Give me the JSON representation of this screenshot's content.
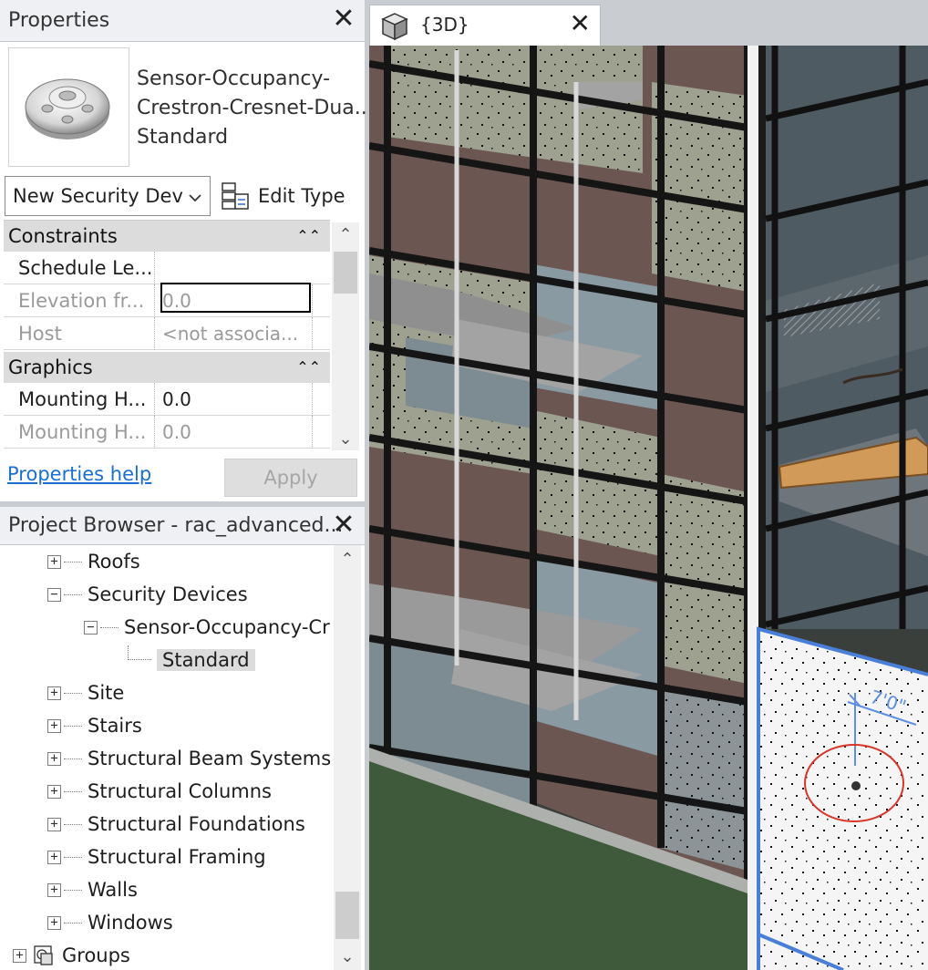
{
  "properties": {
    "title": "Properties",
    "type_lines": [
      "Sensor-Occupancy-",
      "Crestron-Cresnet-Dua...",
      "Standard"
    ],
    "type_selector_value": "New Security Dev",
    "edit_type_label": "Edit Type",
    "categories": [
      {
        "name": "Constraints",
        "rows": [
          {
            "name": "Schedule Le...",
            "value": ""
          },
          {
            "name": "Elevation fr...",
            "value": "0.0"
          },
          {
            "name": "Host",
            "value": "<not associa..."
          }
        ]
      },
      {
        "name": "Graphics",
        "rows": [
          {
            "name": "Mounting H...",
            "value": "0.0"
          },
          {
            "name": "Mounting H...",
            "value": "0.0"
          }
        ]
      }
    ],
    "help_link": "Properties help",
    "apply_label": "Apply"
  },
  "browser": {
    "title": "Project Browser - rac_advanced...",
    "nodes": [
      {
        "label": "Roofs",
        "level": 1,
        "expander": "+"
      },
      {
        "label": "Security Devices",
        "level": 1,
        "expander": "−"
      },
      {
        "label": "Sensor-Occupancy-Cr",
        "level": 2,
        "expander": "−"
      },
      {
        "label": "Standard",
        "level": 3,
        "expander": ""
      },
      {
        "label": "Site",
        "level": 1,
        "expander": "+"
      },
      {
        "label": "Stairs",
        "level": 1,
        "expander": "+"
      },
      {
        "label": "Structural Beam Systems",
        "level": 1,
        "expander": "+"
      },
      {
        "label": "Structural Columns",
        "level": 1,
        "expander": "+"
      },
      {
        "label": "Structural Foundations",
        "level": 1,
        "expander": "+"
      },
      {
        "label": "Structural Framing",
        "level": 1,
        "expander": "+"
      },
      {
        "label": "Walls",
        "level": 1,
        "expander": "+"
      },
      {
        "label": "Windows",
        "level": 1,
        "expander": "+"
      },
      {
        "label": "Groups",
        "level": 0,
        "expander": "+"
      }
    ]
  },
  "view": {
    "tab_label": "{3D}",
    "dimension_text": "7'0\""
  },
  "icons": {
    "close": "close-icon",
    "view_cube": "view-cube-icon",
    "edit_type": "edit-type-icon",
    "groups": "groups-icon",
    "sensor_preview": "occupancy-sensor-preview-icon"
  },
  "colors": {
    "panel_header": "#eef0f3",
    "category_row": "#dcdcdc",
    "link": "#1a6fd1",
    "selection_highlight": "#4a7fd9",
    "annotation_circle": "#d9362b",
    "ground": "#3f5a3a"
  }
}
